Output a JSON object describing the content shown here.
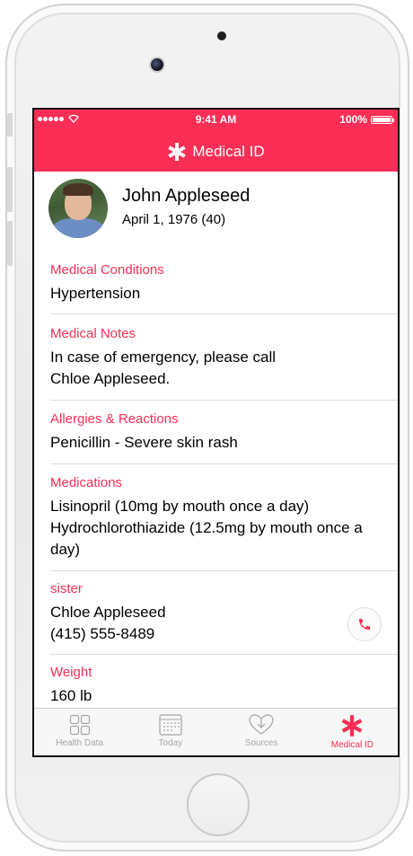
{
  "status_bar": {
    "time": "9:41 AM",
    "battery": "100%"
  },
  "nav": {
    "title": "Medical ID",
    "icon": "asterisk-icon"
  },
  "profile": {
    "name": "John Appleseed",
    "dob": "April 1, 1976 (40)"
  },
  "sections": [
    {
      "label": "Medical Conditions",
      "value": "Hypertension"
    },
    {
      "label": "Medical Notes",
      "value": "In case of emergency, please call\nChloe Appleseed."
    },
    {
      "label": "Allergies & Reactions",
      "value": "Penicillin - Severe skin rash"
    },
    {
      "label": "Medications",
      "value": "Lisinopril (10mg by mouth once a day)\nHydrochlorothiazide (12.5mg by mouth once a day)"
    },
    {
      "label": "sister",
      "value": "Chloe Appleseed\n(415) 555-8489"
    },
    {
      "label": "Weight",
      "value": "160 lb"
    }
  ],
  "tabs": [
    {
      "label": "Health Data",
      "icon": "grid-icon"
    },
    {
      "label": "Today",
      "icon": "calendar-icon"
    },
    {
      "label": "Sources",
      "icon": "download-heart-icon"
    },
    {
      "label": "Medical ID",
      "icon": "asterisk-icon"
    }
  ],
  "colors": {
    "accent": "#fb2e56",
    "tab_inactive": "#a5a5a5"
  }
}
